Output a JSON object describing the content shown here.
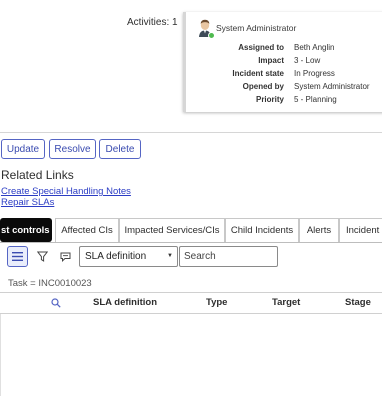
{
  "activities": {
    "label": "Activities: 1",
    "card": {
      "author": "System Administrator",
      "fields": [
        {
          "label": "Assigned to",
          "value": "Beth Anglin"
        },
        {
          "label": "Impact",
          "value": "3 - Low"
        },
        {
          "label": "Incident state",
          "value": "In Progress"
        },
        {
          "label": "Opened by",
          "value": "System Administrator"
        },
        {
          "label": "Priority",
          "value": "5 - Planning"
        }
      ]
    }
  },
  "buttons": {
    "update": "Update",
    "resolve": "Resolve",
    "delete": "Delete"
  },
  "related_links": {
    "title": "Related Links",
    "links": [
      "Create Special Handling Notes",
      "Repair SLAs"
    ]
  },
  "tabs": [
    {
      "label": "st controls",
      "active": true
    },
    {
      "label": "Affected CIs"
    },
    {
      "label": "Impacted Services/CIs"
    },
    {
      "label": "Child Incidents"
    },
    {
      "label": "Alerts"
    },
    {
      "label": "Incident"
    }
  ],
  "toolbar": {
    "menu_icon": "hamburger-menu-icon",
    "filter_icon": "filter-funnel-icon",
    "chat_icon": "chat-bubble-icon",
    "select_value": "SLA definition",
    "search_placeholder": "Search"
  },
  "filter": {
    "breadcrumb": "Task = INC0010023"
  },
  "table": {
    "columns": [
      "SLA definition",
      "Type",
      "Target",
      "Stage"
    ]
  },
  "colors": {
    "accent": "#3a4bb0",
    "link": "#2b3cc4",
    "active_tab": "#0a0a0a",
    "online_status": "#4fba4f"
  }
}
